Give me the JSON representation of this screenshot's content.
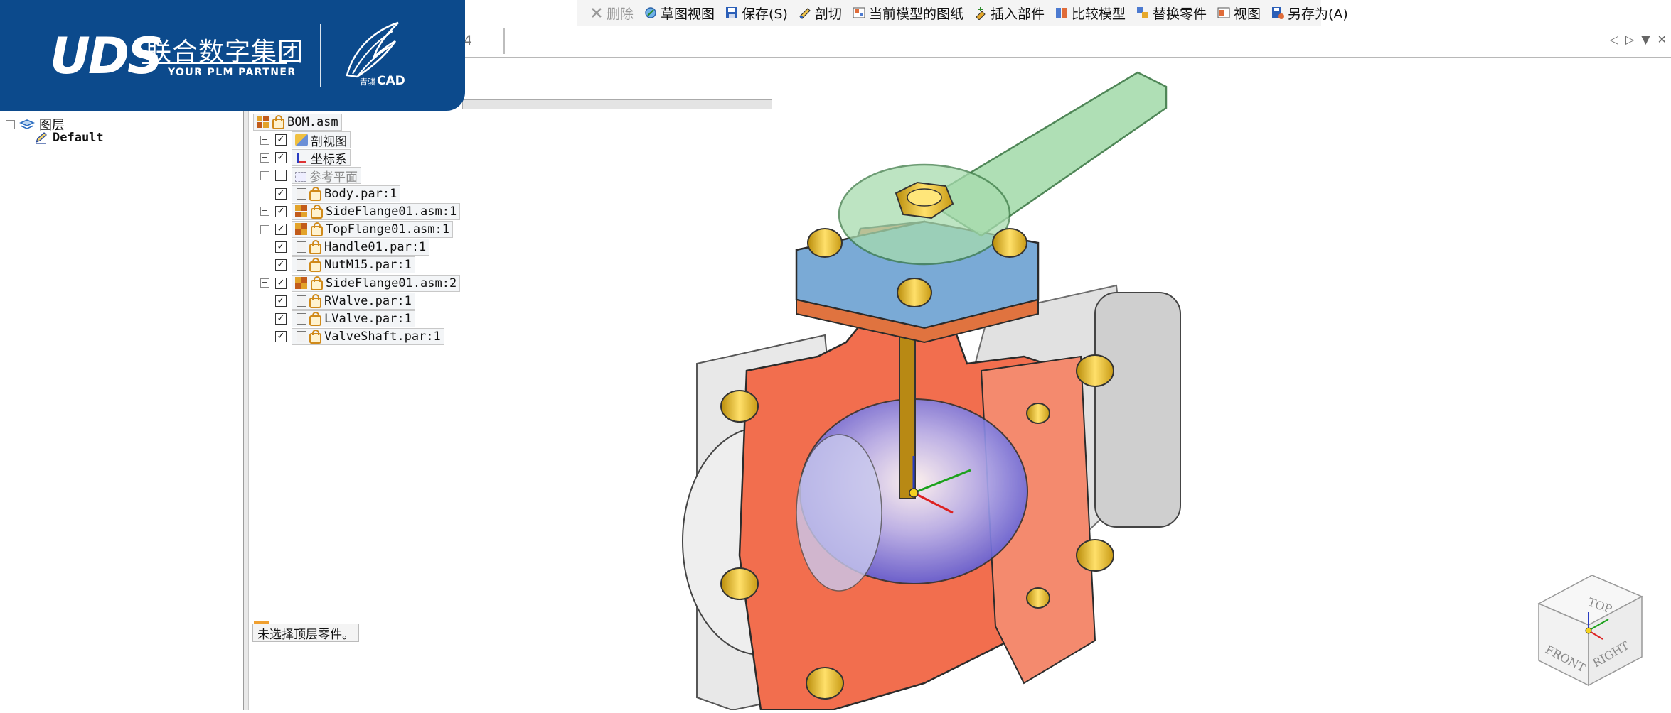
{
  "toolbar": {
    "items": [
      {
        "label": "删除",
        "icon": "delete-x-icon",
        "enabled": false
      },
      {
        "label": "草图视图",
        "icon": "sketch-view-icon",
        "enabled": true
      },
      {
        "label": "保存(S)",
        "icon": "save-icon",
        "enabled": true
      },
      {
        "label": "剖切",
        "icon": "section-cut-icon",
        "enabled": true
      },
      {
        "label": "当前模型的图纸",
        "icon": "drawing-icon",
        "enabled": true
      },
      {
        "label": "插入部件",
        "icon": "insert-part-icon",
        "enabled": true
      },
      {
        "label": "比较模型",
        "icon": "compare-icon",
        "enabled": true
      },
      {
        "label": "替换零件",
        "icon": "replace-part-icon",
        "enabled": true
      },
      {
        "label": "视图",
        "icon": "view-icon",
        "enabled": true
      },
      {
        "label": "另存为(A)",
        "icon": "save-as-icon",
        "enabled": true
      }
    ]
  },
  "tabbar": {
    "stub_label": "4"
  },
  "banner": {
    "brand": "UDS",
    "company": "联合数字集团",
    "tagline": "YOUR PLM PARTNER",
    "product_small": "青骐",
    "product": "CAD",
    "colors": {
      "background": "#0c4a8c"
    }
  },
  "layers": {
    "root": "图层",
    "items": [
      "Default"
    ]
  },
  "tree": {
    "root": "BOM.asm",
    "rows": [
      {
        "label": "剖视图",
        "expandable": true,
        "checked": true,
        "icon": "section-view-icon",
        "dim": false
      },
      {
        "label": "坐标系",
        "expandable": true,
        "checked": true,
        "icon": "coordinate-system-icon",
        "dim": false
      },
      {
        "label": "参考平面",
        "expandable": true,
        "checked": false,
        "icon": "reference-plane-icon",
        "dim": true
      },
      {
        "label": "Body.par:1",
        "expandable": false,
        "checked": true,
        "icon": "part-icon",
        "dim": false
      },
      {
        "label": "SideFlange01.asm:1",
        "expandable": true,
        "checked": true,
        "icon": "assembly-icon",
        "dim": false
      },
      {
        "label": "TopFlange01.asm:1",
        "expandable": true,
        "checked": true,
        "icon": "assembly-icon",
        "dim": false
      },
      {
        "label": "Handle01.par:1",
        "expandable": false,
        "checked": true,
        "icon": "part-icon",
        "dim": false
      },
      {
        "label": "NutM15.par:1",
        "expandable": false,
        "checked": true,
        "icon": "part-icon",
        "dim": false
      },
      {
        "label": "SideFlange01.asm:2",
        "expandable": true,
        "checked": true,
        "icon": "assembly-icon",
        "dim": false
      },
      {
        "label": "RValve.par:1",
        "expandable": false,
        "checked": true,
        "icon": "part-icon",
        "dim": false
      },
      {
        "label": "LValve.par:1",
        "expandable": false,
        "checked": true,
        "icon": "part-icon",
        "dim": false
      },
      {
        "label": "ValveShaft.par:1",
        "expandable": false,
        "checked": true,
        "icon": "part-icon",
        "dim": false
      }
    ]
  },
  "status": {
    "message": "未选择顶层零件。"
  },
  "view_cube": {
    "top": "TOP",
    "front": "FRONT",
    "right": "RIGHT"
  },
  "colors": {
    "body": "#f26e4e",
    "flange_top": "#6e9fcf",
    "bolt": "#e8c22c",
    "handle": "#9fd5a5",
    "ball": "#7f7fe6"
  }
}
